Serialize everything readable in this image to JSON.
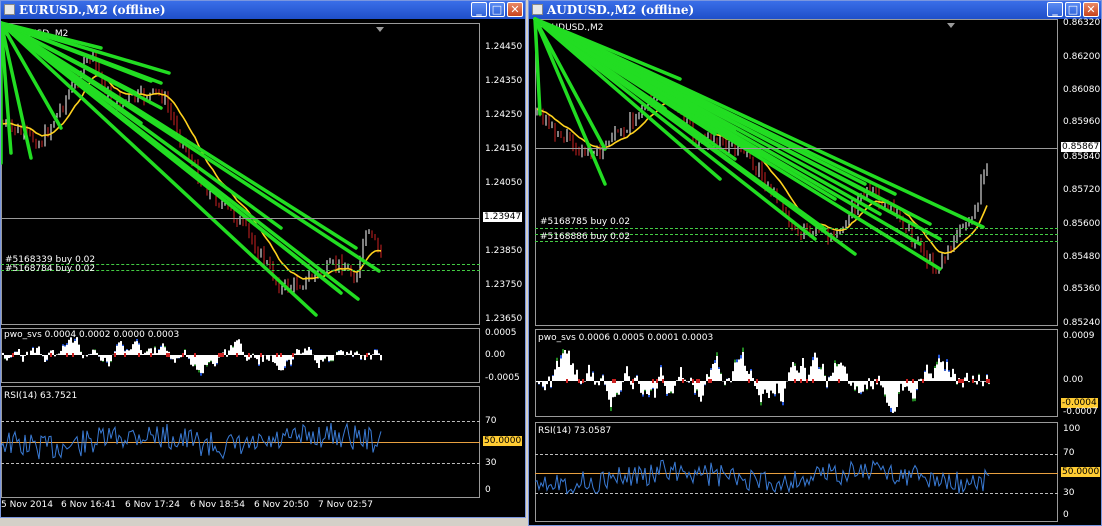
{
  "left": {
    "title": "EURUSD.,M2 (offline)",
    "symbol_label": "EURUSD.,M2",
    "price_scale": [
      "1.24450",
      "1.24350",
      "1.24250",
      "1.24150",
      "1.24050",
      "1.23850",
      "1.23750",
      "1.23650"
    ],
    "current_price": "1.23947",
    "orders": [
      "#5168339 buy 0.02",
      "#5168784 buy 0.02"
    ],
    "pwo_label": "pwo_svs 0.0004 0.0002 0.0000 0.0003",
    "pwo_scale": [
      "0.0005",
      "0.00",
      "-0.0005"
    ],
    "rsi_label": "RSI(14) 63.7521",
    "rsi_scale": [
      "70",
      "30",
      "0"
    ],
    "rsi_level": "50.0000",
    "time_axis": [
      "5 Nov 2014",
      "6 Nov 16:41",
      "6 Nov 17:24",
      "6 Nov 18:54",
      "6 Nov 20:50",
      "7 Nov 02:57"
    ]
  },
  "right": {
    "title": "AUDUSD.,M2 (offline)",
    "symbol_label": "AUDUSD.,M2",
    "price_scale": [
      "0.86320",
      "0.86200",
      "0.86080",
      "0.85960",
      "0.85840",
      "0.85720",
      "0.85600",
      "0.85480",
      "0.85360",
      "0.85240"
    ],
    "current_price": "0.85867",
    "orders": [
      "#5168785 buy 0.02",
      "#5168886 buy 0.02"
    ],
    "pwo_label": "pwo_svs 0.0006 0.0005 0.0001 0.0003",
    "pwo_scale": [
      "0.0009",
      "0.00",
      "-0.0007"
    ],
    "pwo_tag": "-0.0004",
    "rsi_label": "RSI(14) 73.0587",
    "rsi_scale": [
      "100",
      "70",
      "30",
      "0"
    ],
    "rsi_level": "50.0000"
  },
  "window_buttons": {
    "minimize": "_",
    "maximize": "□",
    "close": "✕"
  },
  "colors": {
    "background": "#000000",
    "candle_bull": "#ffffff",
    "candle_bear": "#cc2222",
    "ma": "#ffd21e",
    "trend": "#22dd22",
    "rsi": "#3a7bd5",
    "level_tag": "#ffcc33"
  }
}
